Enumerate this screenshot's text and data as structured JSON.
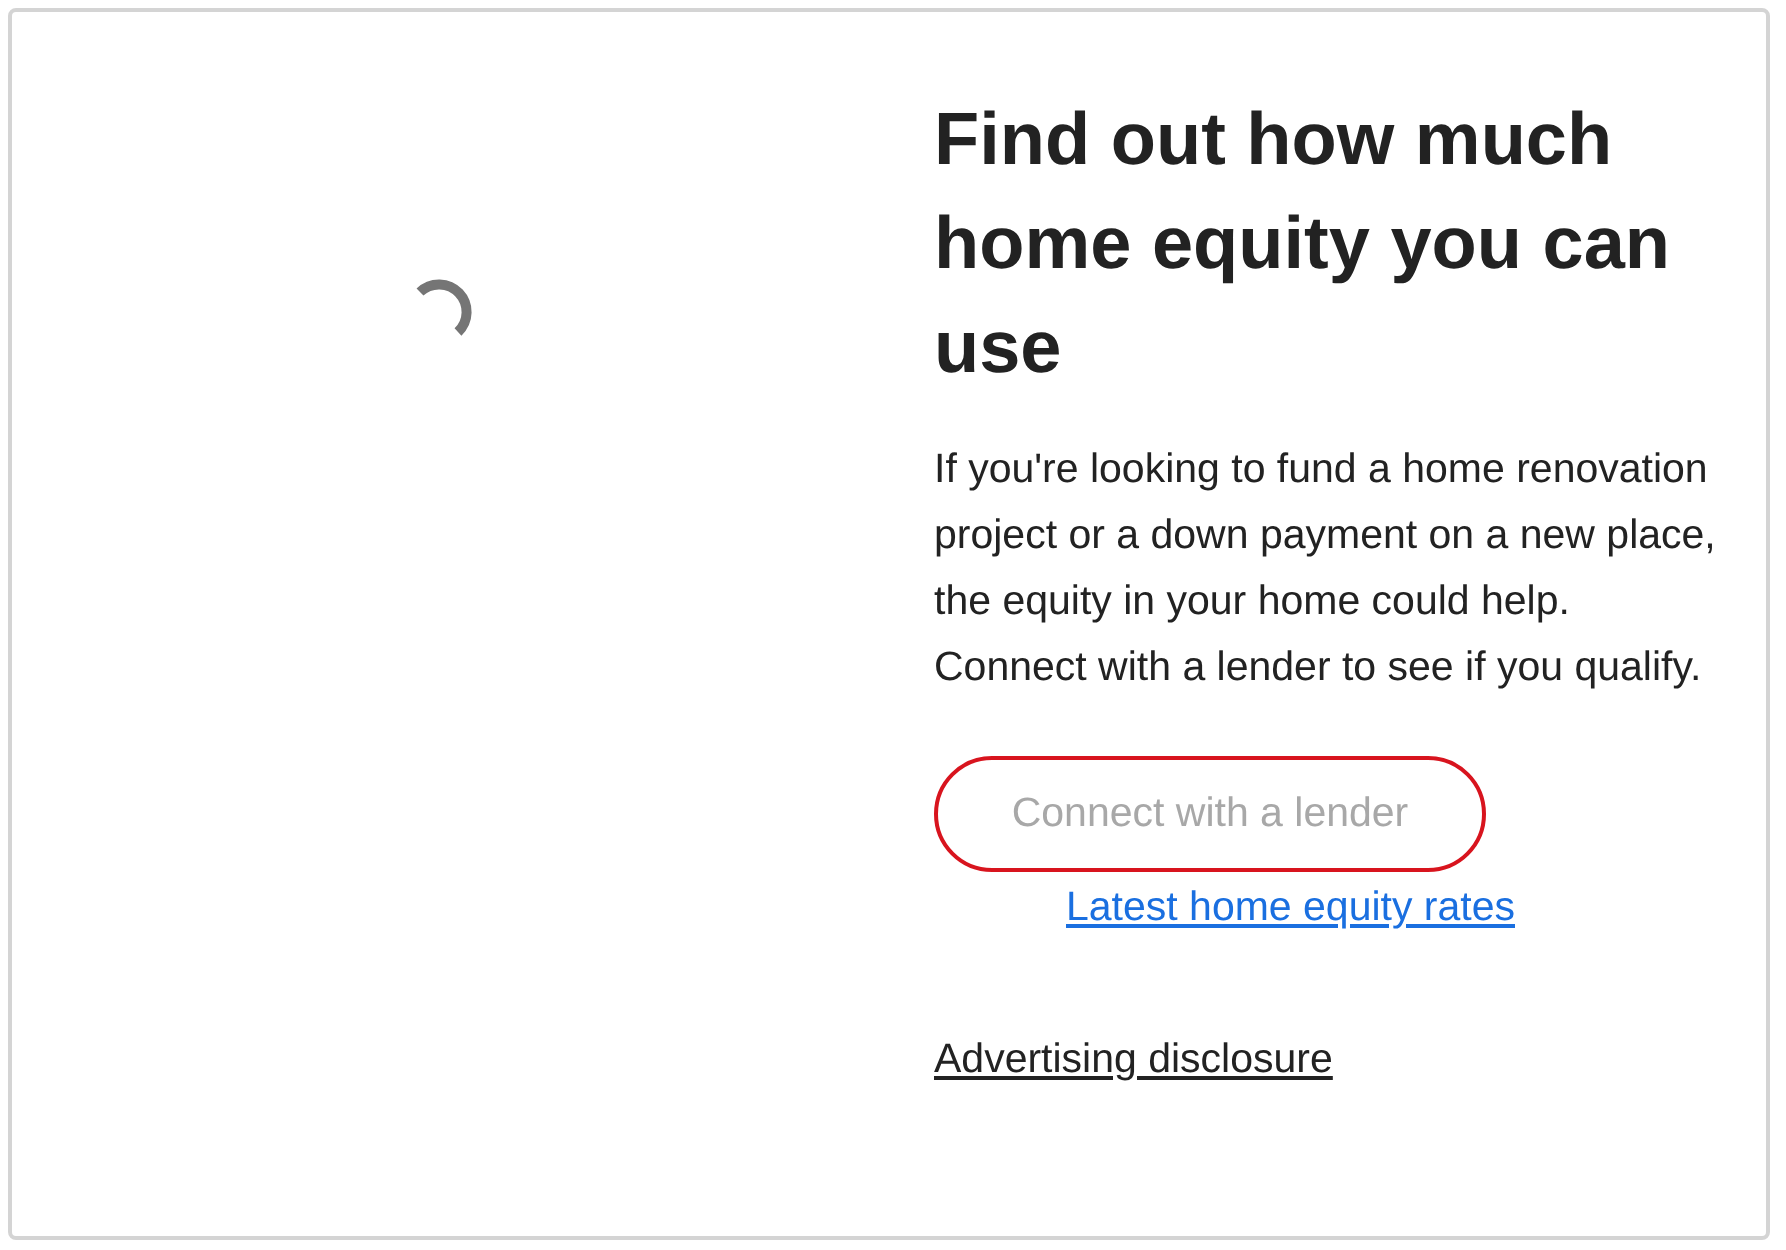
{
  "loading": true,
  "heading": "Find out how much home equity you can use",
  "body": "If you're looking to fund a home renovation project or a down payment on a new place, the equity in your home could help. Connect with a lender to see if you qualify.",
  "button": {
    "label": "Connect with a lender",
    "disabled": true
  },
  "rates_link": "Latest home equity rates",
  "disclosure_link": "Advertising disclosure"
}
